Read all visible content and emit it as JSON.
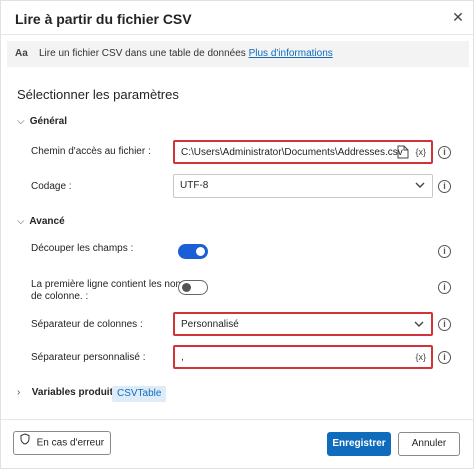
{
  "dialog": {
    "title": "Lire à partir du fichier CSV",
    "close_glyph": "✕"
  },
  "info": {
    "icon_text": "Aa",
    "text": "Lire un fichier CSV dans une table de données",
    "link": "Plus d'informations"
  },
  "section_title": "Sélectionner les paramètres",
  "groups": {
    "general": "Général",
    "advanced": "Avancé"
  },
  "fields": {
    "file_path": {
      "label": "Chemin d'accès au fichier :",
      "value": "C:\\Users\\Administrator\\Documents\\Addresses.csv",
      "fx": "{x}"
    },
    "encoding": {
      "label": "Codage :",
      "value": "UTF-8"
    },
    "trim_fields": {
      "label": "Découper les champs :",
      "state": true
    },
    "first_line_headers": {
      "label_line1": "La première ligne contient les noms",
      "label_line2": "de colonne. :",
      "state": false
    },
    "column_separator": {
      "label": "Séparateur de colonnes :",
      "value": "Personnalisé"
    },
    "custom_separator": {
      "label": "Séparateur personnalisé :",
      "value": ",",
      "fx": "{x}"
    }
  },
  "produced": {
    "label": "Variables produites",
    "badge": "CSVTable"
  },
  "buttons": {
    "on_error": "En cas d'erreur",
    "save": "Enregistrer",
    "cancel": "Annuler"
  },
  "help_glyph": "i",
  "chevrons": {
    "expanded": "⌵",
    "collapsed": "›"
  },
  "colors": {
    "accent": "#0f6cbd",
    "toggle_on": "#1a5fd6",
    "highlight": "#d13438"
  }
}
